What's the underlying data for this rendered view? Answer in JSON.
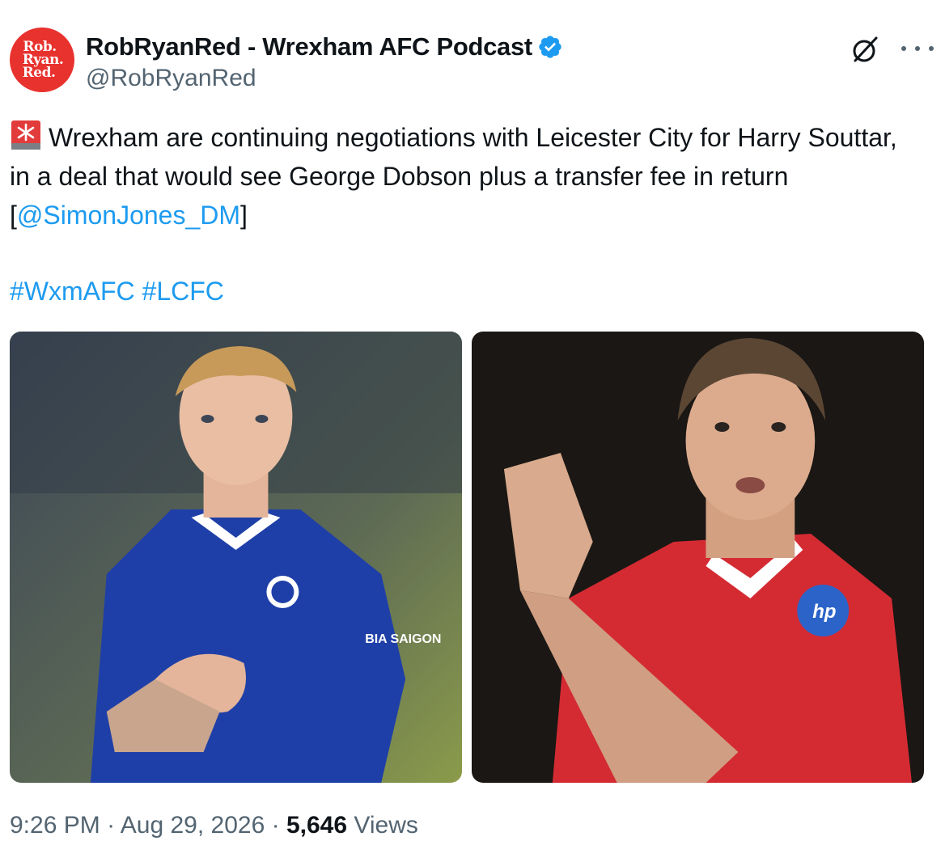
{
  "author": {
    "avatar_lines": [
      "Rob.",
      "Ryan.",
      "Red."
    ],
    "display_name": "RobRyanRed - Wrexham AFC Podcast",
    "handle": "@RobRyanRed",
    "verified": true
  },
  "icons": {
    "grok": "grok-icon",
    "more": "more-icon",
    "alarm": "rotating-light-emoji",
    "verified": "verified-badge-icon"
  },
  "tweet": {
    "text_part1": "Wrexham are continuing negotiations with Leicester City for Harry Souttar, in a deal that would see George Dobson plus a transfer fee in return [",
    "mention": "@SimonJones_DM",
    "text_part2": "]",
    "hashtags": [
      "#WxmAFC",
      "#LCFC"
    ]
  },
  "media": [
    {
      "kit_text": "BIA SAIGON"
    },
    {
      "kit_text": "hp"
    }
  ],
  "meta": {
    "time": "9:26 PM",
    "separator": "·",
    "date": "Aug 29, 2026",
    "views_count": "5,646",
    "views_label": "Views"
  },
  "colors": {
    "link": "#1d9bf0",
    "muted": "#536471",
    "text": "#0f1419",
    "avatar_bg": "#e8322e"
  }
}
